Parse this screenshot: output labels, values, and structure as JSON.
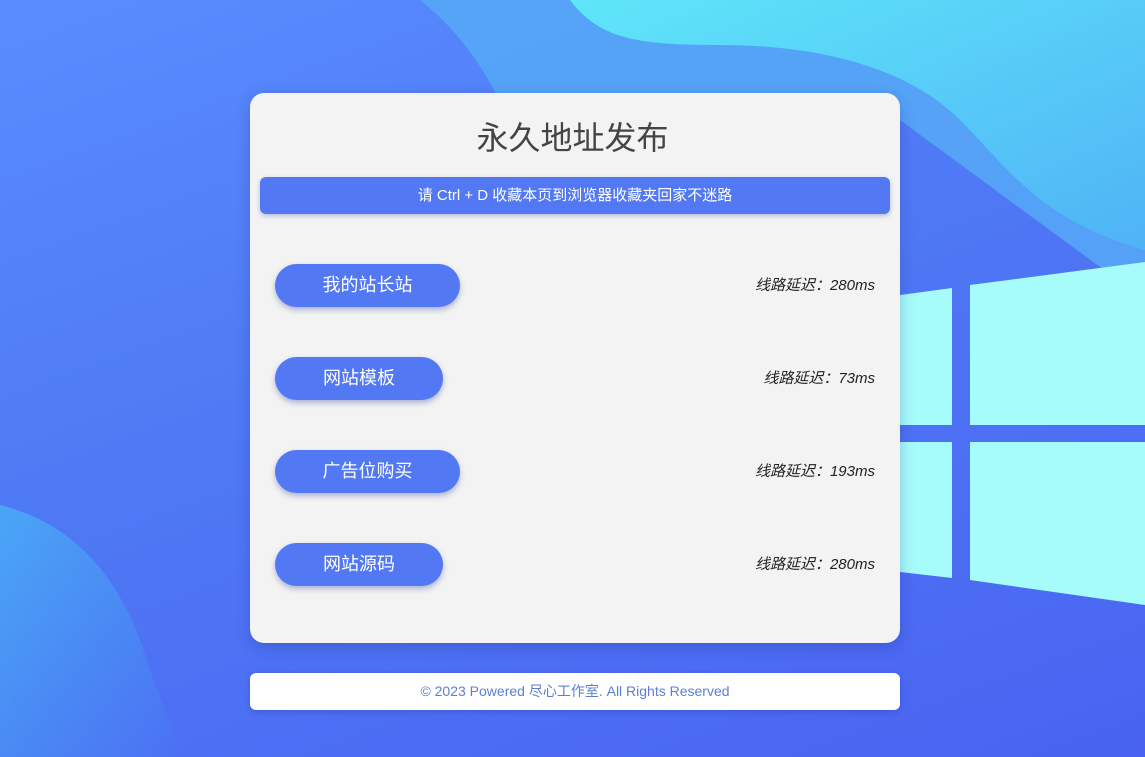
{
  "page": {
    "title": "永久地址发布",
    "notice": "请 Ctrl + D 收藏本页到浏览器收藏夹回家不迷路"
  },
  "links": [
    {
      "label": "我的站长站",
      "latency": "线路延迟：280ms"
    },
    {
      "label": "网站模板",
      "latency": "线路延迟：73ms"
    },
    {
      "label": "广告位购买",
      "latency": "线路延迟：193ms"
    },
    {
      "label": "网站源码",
      "latency": "线路延迟：280ms"
    }
  ],
  "footer": {
    "text": "© 2023 Powered 尽心工作室. All Rights Reserved"
  },
  "colors": {
    "accent": "#5278f3",
    "card_bg": "#f3f3f3",
    "footer_text": "#5a7fd6"
  },
  "background": {
    "decoration": "windows-logo-icon"
  }
}
